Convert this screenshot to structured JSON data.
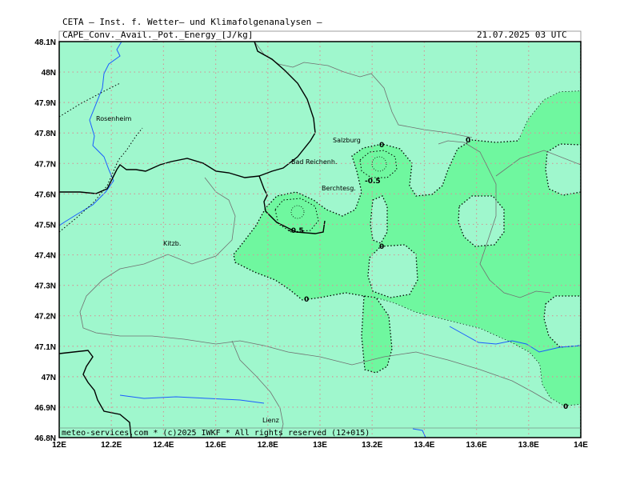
{
  "header": {
    "institute": "CETA — Inst. f. Wetter— und Klimafolgenanalysen —",
    "parameter": "CAPE_Conv._Avail._Pot._Energy_[J/kg]",
    "datetime": "21.07.2025 03 UTC"
  },
  "footer": {
    "credit": "meteo-services.com * (c)2025 IWKF * All rights reserved (12+015)"
  },
  "axes": {
    "lon_labels": [
      "12E",
      "12.2E",
      "12.4E",
      "12.6E",
      "12.8E",
      "13E",
      "13.2E",
      "13.4E",
      "13.6E",
      "13.8E",
      "14E"
    ],
    "lat_labels": [
      "48.1N",
      "48N",
      "47.9N",
      "47.8N",
      "47.7N",
      "47.6N",
      "47.5N",
      "47.4N",
      "47.3N",
      "47.2N",
      "47.1N",
      "47N",
      "46.9N",
      "46.8N"
    ],
    "lon_range": [
      12.0,
      14.0
    ],
    "lat_range": [
      46.8,
      48.1
    ],
    "grid": "dotted"
  },
  "places": [
    {
      "name": "Rosenheim"
    },
    {
      "name": "Salzburg"
    },
    {
      "name": "Bad Reichenh."
    },
    {
      "name": "Berchtesg."
    },
    {
      "name": "Kitzb."
    },
    {
      "name": "Lienz"
    }
  ],
  "contour_labels": [
    {
      "text": "0"
    },
    {
      "text": "-0.5"
    },
    {
      "text": "-0.5"
    },
    {
      "text": "0"
    },
    {
      "text": "0"
    },
    {
      "text": "0"
    }
  ],
  "colors": {
    "field_light": "#9ff7cd",
    "field_mid": "#6ff79f",
    "grid": "#d09a9a",
    "river": "#1a5cff",
    "border": "#000000",
    "province": "#707070"
  }
}
